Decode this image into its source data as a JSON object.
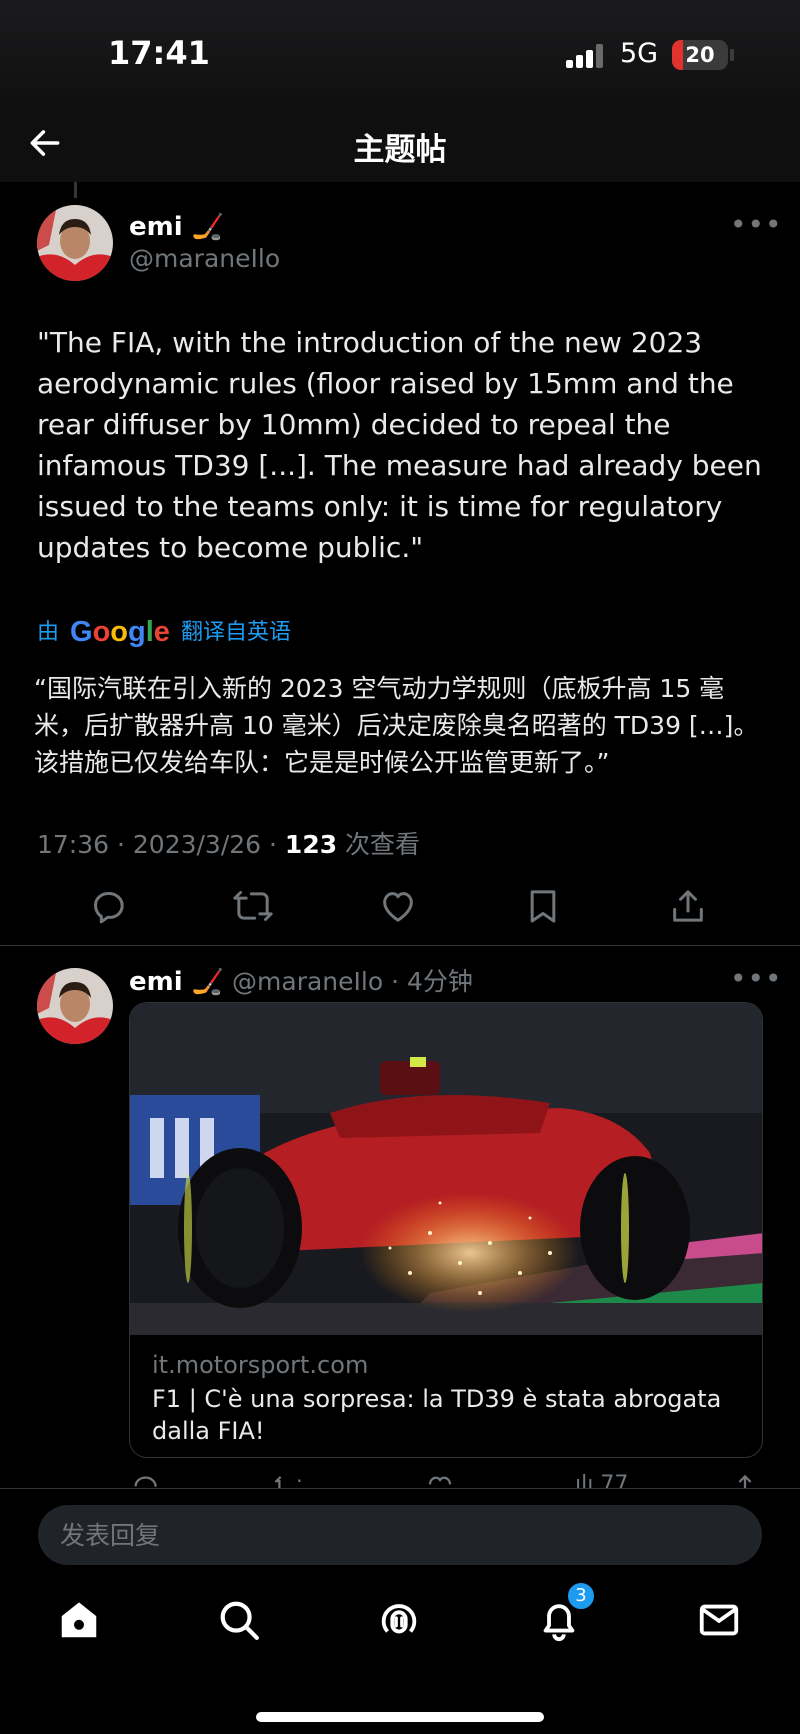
{
  "status_bar": {
    "time": "17:41",
    "network": "5G",
    "battery": "20",
    "battery_fraction": 0.2
  },
  "header": {
    "title": "主题帖",
    "back_icon": "arrow-left-icon"
  },
  "main_post": {
    "author_name": "emi 🏒",
    "author_handle": "@maraneIlo",
    "text": "\"The FIA, with the introduction of the new 2023 aerodynamic rules (floor raised by 15mm and the rear diffuser by 10mm) decided to repeal the infamous TD39 [...]. The measure had already been issued to the teams only: it is time for regulatory updates to become public.\"",
    "translate_prefix": "由",
    "translate_brand": "Google",
    "translate_suffix": "翻译自英语",
    "translated_text": "“国际汽联在引入新的 2023 空气动力学规则（底板升高 15 毫米，后扩散器升高 10 毫米）后决定废除臭名昭著的 TD39 […]。该措施已仅发给车队：它是是时候公开监管更新了。”",
    "timestamp": "17:36 · 2023/3/26 · ",
    "views_count": "123",
    "views_label": " 次查看",
    "actions": [
      "reply-icon",
      "retweet-icon",
      "like-icon",
      "bookmark-icon",
      "share-icon"
    ]
  },
  "reply_post": {
    "author_name": "emi 🏒",
    "author_handle": "@maraneIlo",
    "separator": " · ",
    "time_ago": "4分钟",
    "card": {
      "domain": "it.motorsport.com",
      "title": "F1 | C'è una sorpresa: la TD39 è stata abrogata dalla FIA!"
    },
    "views_partial": "77"
  },
  "reply_bar": {
    "placeholder": "发表回复"
  },
  "tabbar": {
    "items": [
      "home-icon",
      "search-icon",
      "spaces-icon",
      "notifications-icon",
      "messages-icon"
    ],
    "notifications_badge": "3"
  },
  "colors": {
    "accent": "#1d9bf0",
    "background": "#000000",
    "muted": "#71767b"
  }
}
